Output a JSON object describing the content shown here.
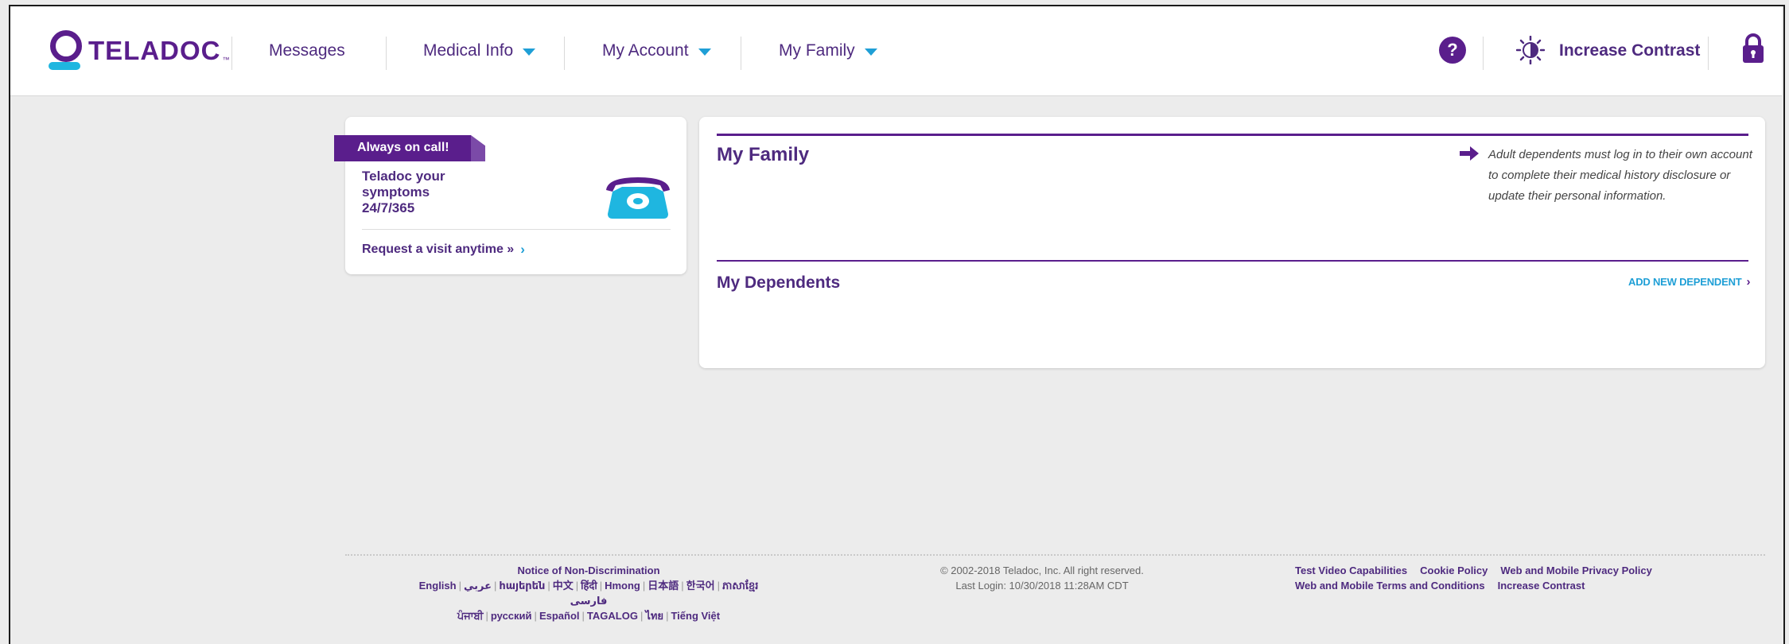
{
  "header": {
    "brand": "TELADOC",
    "tm": "™",
    "nav": [
      {
        "label": "Messages",
        "dropdown": false
      },
      {
        "label": "Medical Info",
        "dropdown": true
      },
      {
        "label": "My Account",
        "dropdown": true
      },
      {
        "label": "My Family",
        "dropdown": true
      }
    ],
    "help_glyph": "?",
    "contrast_label": "Increase Contrast"
  },
  "promo": {
    "ribbon": "Always on call!",
    "lines": [
      "Teladoc your",
      "symptoms",
      "24/7/365"
    ],
    "link": "Request a visit anytime »",
    "link_chevron": "›"
  },
  "family": {
    "title": "My Family",
    "note": "Adult dependents must log in to their own account to complete their medical history disclosure or update their personal information.",
    "dependents_title": "My Dependents",
    "add_dependent": "ADD NEW DEPENDENT",
    "add_chevron": "›"
  },
  "footer": {
    "notice": "Notice of Non-Discrimination",
    "languages_row1": [
      "English",
      "عربي",
      "հայերեն",
      "中文",
      "हिंदी",
      "Hmong",
      "日本語",
      "한국어",
      "ភាសាខ្មែរ"
    ],
    "languages_row1b": "فارسی",
    "languages_row2": [
      "ਪੰਜਾਬੀ",
      "русский",
      "Español",
      "TAGALOG",
      "ไทย",
      "Tiếng Việt"
    ],
    "copyright": "© 2002-2018 Teladoc, Inc. All right reserved.",
    "last_login": "Last Login: 10/30/2018 11:28AM CDT",
    "links_row1": [
      "Test Video Capabilities",
      "Cookie Policy",
      "Web and Mobile Privacy Policy"
    ],
    "links_row2": [
      "Web and Mobile Terms and Conditions",
      "Increase Contrast"
    ]
  },
  "colors": {
    "brand_purple": "#5a1e8c",
    "accent_blue": "#1f9fd6",
    "background": "#ececec"
  },
  "icons": {
    "logo": "teladoc-logo-icon",
    "help": "question-circle-icon",
    "contrast": "contrast-sun-icon",
    "lock": "lock-icon",
    "phone": "telephone-icon",
    "info_arrow": "arrow-right-icon"
  }
}
